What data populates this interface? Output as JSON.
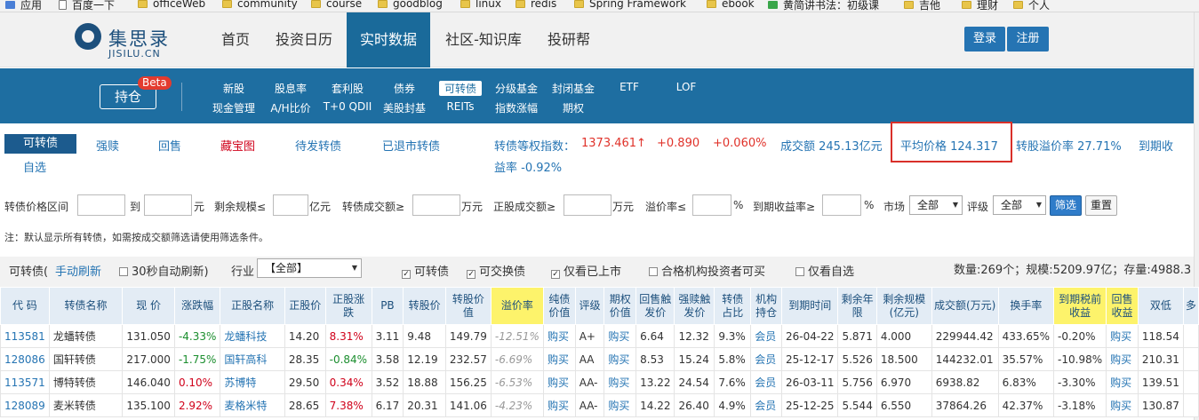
{
  "bookmarks": [
    {
      "label": "应用",
      "icon": "apps-grid-icon"
    },
    {
      "label": "百度一下",
      "icon": "page-icon"
    },
    {
      "label": "officeWeb",
      "icon": "folder-icon"
    },
    {
      "label": "community",
      "icon": "folder-icon"
    },
    {
      "label": "course",
      "icon": "folder-icon"
    },
    {
      "label": "goodblog",
      "icon": "folder-icon"
    },
    {
      "label": "linux",
      "icon": "folder-icon"
    },
    {
      "label": "redis",
      "icon": "folder-icon"
    },
    {
      "label": "Spring Framework",
      "icon": "folder-icon"
    },
    {
      "label": "ebook",
      "icon": "folder-icon"
    },
    {
      "label": "黄简讲书法：初级课",
      "icon": "site-icon"
    },
    {
      "label": "吉他",
      "icon": "folder-icon"
    },
    {
      "label": "理财",
      "icon": "folder-icon"
    },
    {
      "label": "个人",
      "icon": "folder-icon"
    }
  ],
  "header": {
    "logo_title": "集思录",
    "logo_sub": "JISILU.CN",
    "nav": [
      "首页",
      "投资日历",
      "实时数据",
      "社区-知识库",
      "投研帮"
    ],
    "login": "登录",
    "register": "注册"
  },
  "subnav": {
    "hold_label": "持仓",
    "beta": "Beta",
    "row1": [
      "新股",
      "股息率",
      "套利股",
      "债券",
      "可转债",
      "分级基金",
      "封闭基金",
      "ETF",
      "LOF"
    ],
    "row2": [
      "现金管理",
      "A/H比价",
      "T+0 QDII",
      "美股封基",
      "REITs",
      "指数涨幅",
      "期权"
    ]
  },
  "tabs": {
    "convertible": "可转债",
    "redeem": "强赎",
    "resale": "回售",
    "treasure": "藏宝图",
    "pending": "待发转债",
    "delisted": "已退市转债",
    "custom": "自选"
  },
  "metrics": {
    "index_label": "转债等权指数：",
    "index_value": "1373.461↑",
    "change": "+0.890",
    "change_pct": "+0.060%",
    "turnover": "成交额 245.13亿元",
    "avg_price": "平均价格 124.317",
    "premium": "转股溢价率 27.71%",
    "ytm_a": "到期收",
    "ytm_b": "益率 -0.92%"
  },
  "filters": {
    "price_range": "转债价格区间",
    "to": "到",
    "yuan": "元",
    "remain_scale": "剩余规模≤",
    "yi_yuan": "亿元",
    "bond_turnover": "转债成交额≥",
    "wan_yuan1": "万元",
    "stock_turnover": "正股成交额≥",
    "wan_yuan2": "万元",
    "premium_rate": "溢价率≤",
    "pct1": "%",
    "ytm": "到期收益率≥",
    "pct2": "%",
    "market": "市场",
    "market_value": "全部",
    "rating": "评级",
    "rating_value": "全部",
    "filter_btn": "筛选",
    "reset_btn": "重置"
  },
  "note": "注：默认显示所有转债，如需按成交额筛选请使用筛选条件。",
  "options": {
    "label": "可转债(",
    "manual": "手动刷新",
    "auto": "30秒自动刷新)",
    "industry": "行业",
    "industry_value": "【全部】",
    "cb1": "可转债",
    "cb2": "可交换债",
    "cb3": "仅看已上市",
    "cb4": "合格机构投资者可买",
    "cb5": "仅看自选",
    "summary": "数量:269个；规模:5209.97亿；存量:4988.3"
  },
  "table": {
    "headers": [
      "代 码",
      "转债名称",
      "现 价",
      "涨跌幅",
      "正股名称",
      "正股价",
      "正股涨跌",
      "PB",
      "转股价",
      "转股价值",
      "溢价率",
      "纯债价值",
      "评级",
      "期权价值",
      "回售触发价",
      "强赎触发价",
      "转债占比",
      "机构持仓",
      "到期时间",
      "剩余年限",
      "剩余规模(亿元)",
      "成交额(万元)",
      "换手率",
      "到期税前收益",
      "回售收益",
      "双低",
      "多"
    ],
    "rows": [
      [
        "113581",
        "龙蟠转债",
        "131.050",
        "-4.33%",
        "龙蟠科技",
        "14.20",
        "8.31%",
        "3.11",
        "9.48",
        "149.79",
        "-12.51%",
        "购买",
        "A+",
        "购买",
        "6.64",
        "12.32",
        "9.3%",
        "会员",
        "26-04-22",
        "5.871",
        "4.000",
        "229944.42",
        "433.65%",
        "-0.20%",
        "购买",
        "118.54",
        ""
      ],
      [
        "128086",
        "国轩转债",
        "217.000",
        "-1.75%",
        "国轩高科",
        "28.35",
        "-0.84%",
        "3.58",
        "12.19",
        "232.57",
        "-6.69%",
        "购买",
        "AA",
        "购买",
        "8.53",
        "15.24",
        "5.8%",
        "会员",
        "25-12-17",
        "5.526",
        "18.500",
        "144232.01",
        "35.57%",
        "-10.98%",
        "购买",
        "210.31",
        ""
      ],
      [
        "113571",
        "博特转债",
        "146.040",
        "0.10%",
        "苏博特",
        "29.50",
        "0.34%",
        "3.52",
        "18.88",
        "156.25",
        "-6.53%",
        "购买",
        "AA-",
        "购买",
        "13.22",
        "24.54",
        "7.6%",
        "会员",
        "26-03-11",
        "5.756",
        "6.970",
        "6938.82",
        "6.83%",
        "-3.30%",
        "购买",
        "139.51",
        ""
      ],
      [
        "128089",
        "麦米转债",
        "135.100",
        "2.92%",
        "麦格米特",
        "28.65",
        "7.38%",
        "6.17",
        "20.31",
        "141.06",
        "-4.23%",
        "购买",
        "AA-",
        "购买",
        "14.22",
        "26.40",
        "4.9%",
        "会员",
        "25-12-25",
        "5.544",
        "6.550",
        "37864.26",
        "42.37%",
        "-3.18%",
        "购买",
        "130.87",
        ""
      ]
    ]
  }
}
